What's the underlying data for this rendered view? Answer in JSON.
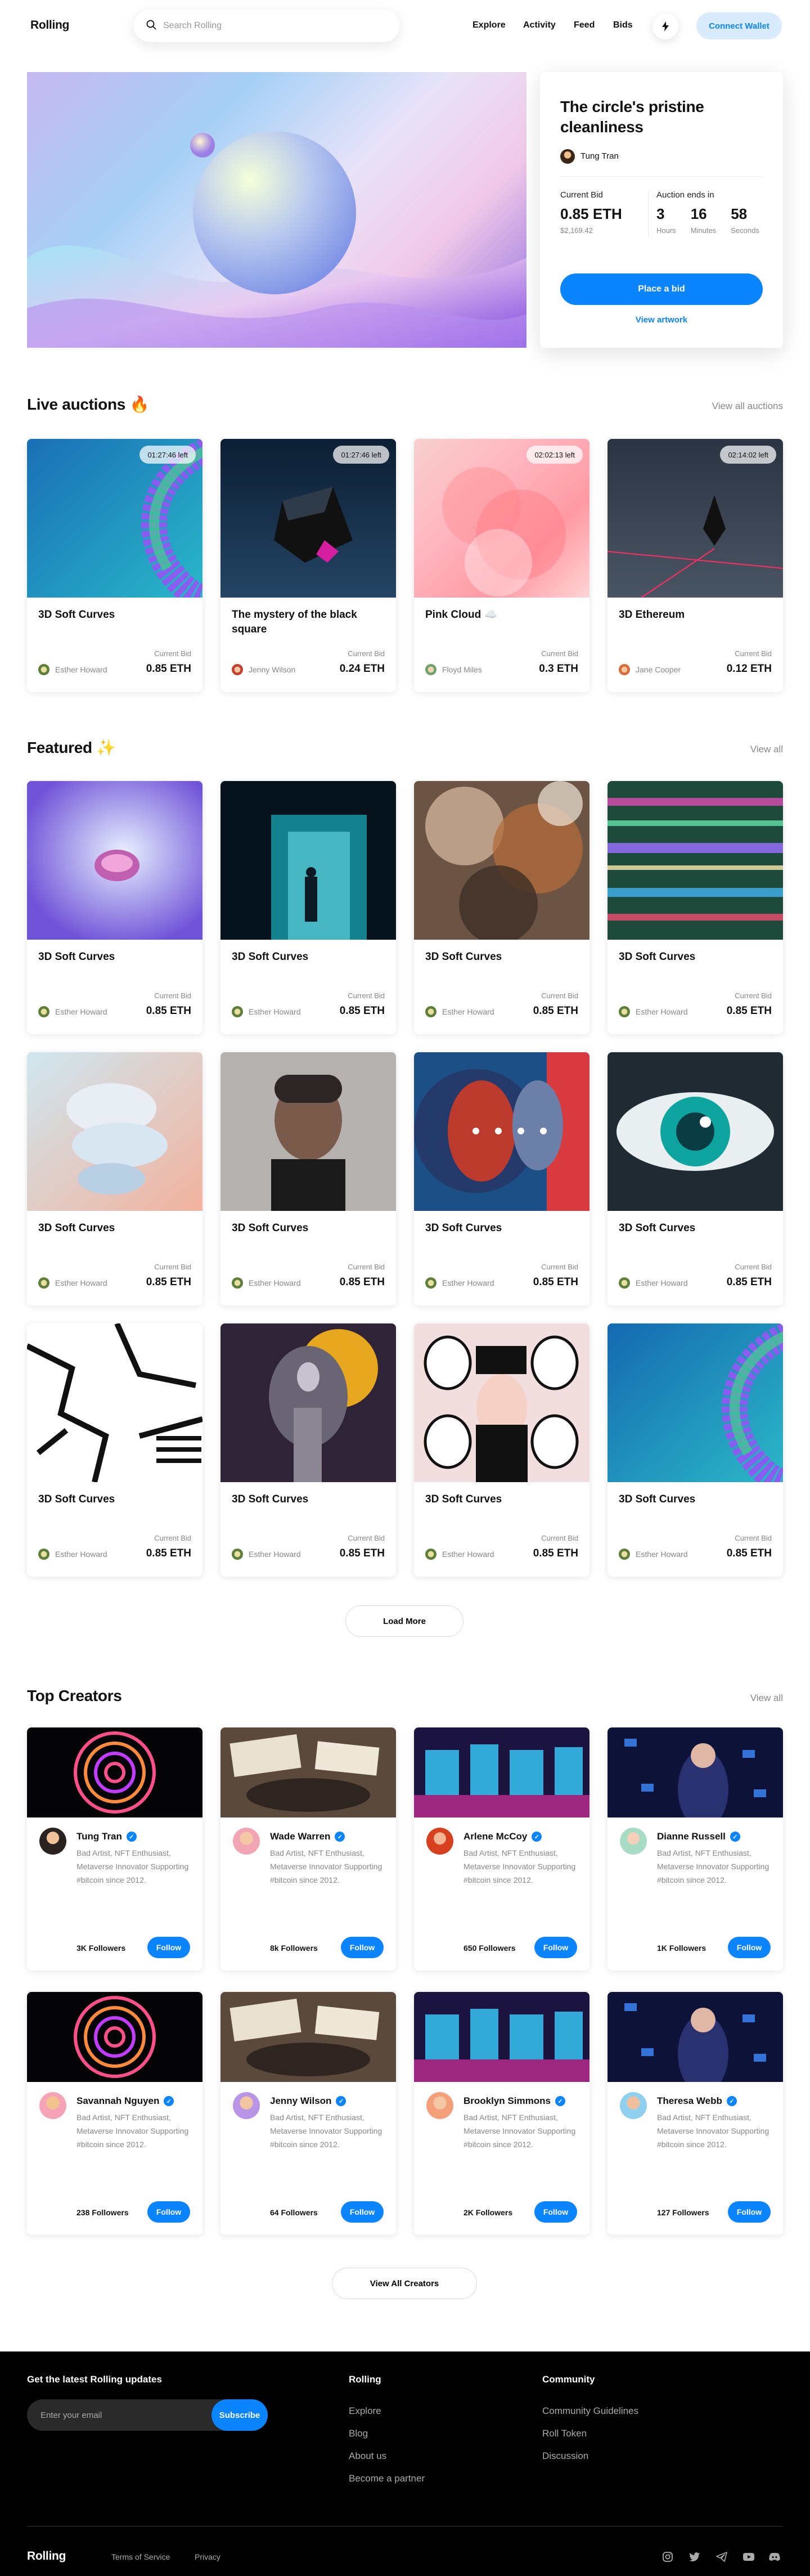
{
  "header": {
    "logo": "Rolling",
    "search_placeholder": "Search Rolling",
    "nav": [
      "Explore",
      "Activity",
      "Feed",
      "Bids"
    ],
    "connect": "Connect Wallet"
  },
  "hero": {
    "title": "The circle's pristine cleanliness",
    "owner": "Tung Tran",
    "current_bid_label": "Current Bid",
    "current_bid": "0.85 ETH",
    "usd": "$2,169.42",
    "ends_label": "Auction ends in",
    "countdown": [
      {
        "n": "3",
        "u": "Hours"
      },
      {
        "n": "16",
        "u": "Minutes"
      },
      {
        "n": "58",
        "u": "Seconds"
      }
    ],
    "cta": "Place a bid",
    "view": "View artwork"
  },
  "live": {
    "title": "Live auctions",
    "emoji": "🔥",
    "link": "View all auctions",
    "items": [
      {
        "name": "3D Soft Curves",
        "timer": "01:27:46 left",
        "author": "Esther Howard",
        "cb": "Current Bid",
        "price": "0.85 ETH"
      },
      {
        "name": "The mystery of the black square",
        "timer": "01:27:46 left",
        "author": "Jenny Wilson",
        "cb": "Current Bid",
        "price": "0.24 ETH"
      },
      {
        "name": "Pink Cloud ☁️",
        "timer": "02:02:13 left",
        "author": "Floyd Miles",
        "cb": "Current Bid",
        "price": "0.3 ETH"
      },
      {
        "name": "3D Ethereum",
        "timer": "02:14:02 left",
        "author": "Jane Cooper",
        "cb": "Current Bid",
        "price": "0.12 ETH"
      }
    ]
  },
  "featured": {
    "title": "Featured",
    "emoji": "✨",
    "link": "View all",
    "item_name": "3D Soft Curves",
    "author": "Esther Howard",
    "cb": "Current Bid",
    "price": "0.85 ETH",
    "load_more": "Load More"
  },
  "creators": {
    "title": "Top Creators",
    "link": "View all",
    "bio": "Bad Artist, NFT Enthusiast, Metaverse Innovator Supporting #bitcoin since 2012.",
    "follow": "Follow",
    "items": [
      {
        "name": "Tung Tran",
        "followers": "3K Followers"
      },
      {
        "name": "Wade Warren",
        "followers": "8k Followers"
      },
      {
        "name": "Arlene McCoy",
        "followers": "650 Followers"
      },
      {
        "name": "Dianne Russell",
        "followers": "1K Followers"
      },
      {
        "name": "Savannah Nguyen",
        "followers": "238 Followers"
      },
      {
        "name": "Jenny Wilson",
        "followers": "64 Followers"
      },
      {
        "name": "Brooklyn Simmons",
        "followers": "2K Followers"
      },
      {
        "name": "Theresa Webb",
        "followers": "127 Followers"
      }
    ],
    "view_all": "View All Creators"
  },
  "footer": {
    "updates": "Get the latest Rolling updates",
    "email_placeholder": "Enter your email",
    "subscribe": "Subscribe",
    "col1": {
      "title": "Rolling",
      "links": [
        "Explore",
        "Blog",
        "About us",
        "Become a partner"
      ]
    },
    "col2": {
      "title": "Community",
      "links": [
        "Community Guidelines",
        "Roll Token",
        "Discussion"
      ]
    },
    "logo": "Rolling",
    "terms": "Terms of Service",
    "privacy": "Privacy"
  }
}
